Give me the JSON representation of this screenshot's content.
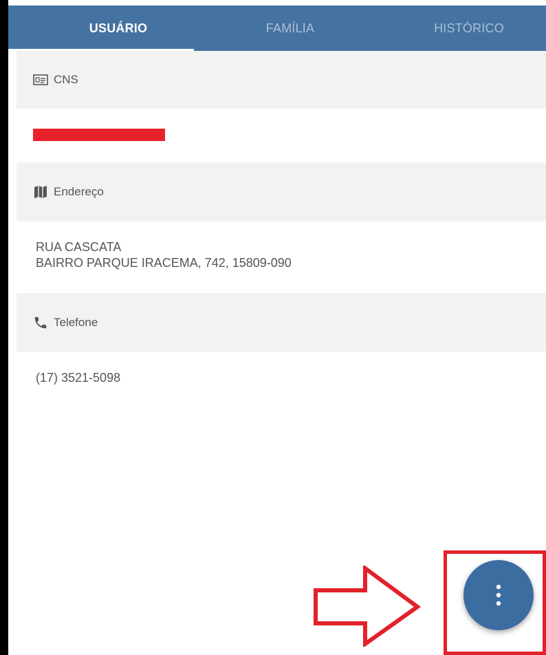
{
  "tabs": [
    {
      "label": "USUÁRIO",
      "active": true
    },
    {
      "label": "FAMÍLIA",
      "active": false
    },
    {
      "label": "HISTÓRICO",
      "active": false
    }
  ],
  "sections": {
    "cns": {
      "label": "CNS",
      "icon": "id-card-icon"
    },
    "endereco": {
      "label": "Endereço",
      "icon": "map-icon",
      "line1": "RUA CASCATA",
      "line2": "BAIRRO PARQUE IRACEMA, 742, 15809-090"
    },
    "telefone": {
      "label": "Telefone",
      "icon": "phone-icon",
      "value": "(17) 3521-5098"
    }
  },
  "fab": {
    "icon": "more-vertical-icon"
  },
  "annotations": {
    "arrow_icon": "arrow-right-outline",
    "highlight_color": "#e3212a"
  },
  "colors": {
    "primary": "#4472a1",
    "fab": "#3c6da0",
    "redaction": "#e8212b"
  }
}
